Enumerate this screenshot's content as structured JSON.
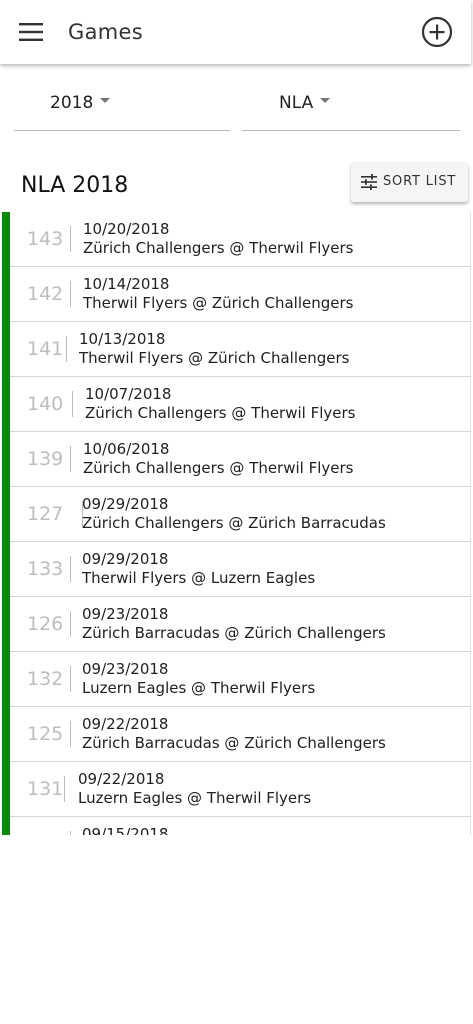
{
  "app_bar": {
    "title": "Games",
    "menu_icon": "hamburger-menu-icon",
    "add_icon": "add-circle-icon"
  },
  "filters": {
    "year": "2018",
    "league": "NLA"
  },
  "section": {
    "title": "NLA 2018",
    "sort_label": "SORT LIST",
    "sort_icon": "tune-sliders-icon"
  },
  "colors": {
    "accent_stripe": "#0a8a0a",
    "muted": "#bdbdbd"
  },
  "games": [
    {
      "number": "143",
      "date": "10/20/2018",
      "teams": "Zürich Challengers @ Therwil Flyers"
    },
    {
      "number": "142",
      "date": "10/14/2018",
      "teams": "Therwil Flyers @ Zürich Challengers"
    },
    {
      "number": "141",
      "date": "10/13/2018",
      "teams": "Therwil Flyers @ Zürich Challengers"
    },
    {
      "number": "140",
      "date": "10/07/2018",
      "teams": "Zürich Challengers @ Therwil Flyers"
    },
    {
      "number": "139",
      "date": "10/06/2018",
      "teams": "Zürich Challengers @ Therwil Flyers"
    },
    {
      "number": "127",
      "date": "09/29/2018",
      "teams": "Zürich Challengers @ Zürich Barracudas"
    },
    {
      "number": "133",
      "date": "09/29/2018",
      "teams": "Therwil Flyers @ Luzern Eagles"
    },
    {
      "number": "126",
      "date": "09/23/2018",
      "teams": "Zürich Barracudas @ Zürich Challengers"
    },
    {
      "number": "132",
      "date": "09/23/2018",
      "teams": "Luzern Eagles @ Therwil Flyers"
    },
    {
      "number": "125",
      "date": "09/22/2018",
      "teams": "Zürich Barracudas @ Zürich Challengers"
    },
    {
      "number": "131",
      "date": "09/22/2018",
      "teams": "Luzern Eagles @ Therwil Flyers"
    },
    {
      "number": "",
      "date": "09/15/2018",
      "teams": ""
    }
  ]
}
